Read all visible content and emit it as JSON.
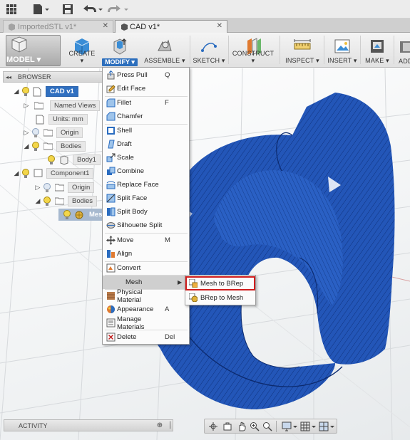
{
  "quick_access": {
    "icons": [
      "grid-icon",
      "file-icon",
      "save-icon",
      "undo-icon",
      "redo-icon"
    ]
  },
  "tabs": [
    {
      "label": "ImportedSTL v1*",
      "active": false
    },
    {
      "label": "CAD v1*",
      "active": true
    }
  ],
  "toolbar": {
    "workspace_label": "MODEL ▾",
    "groups": {
      "create": "CREATE ▾",
      "modify": "MODIFY ▾",
      "assemble": "ASSEMBLE ▾",
      "sketch": "SKETCH ▾",
      "construct": "CONSTRUCT ▾",
      "inspect": "INSPECT ▾",
      "insert": "INSERT ▾",
      "make": "MAKE ▾",
      "addins": "ADD"
    }
  },
  "browser": {
    "title": "BROWSER",
    "collapse_glyph": "◂◂",
    "root": "CAD v1",
    "items": {
      "named_views": "Named Views",
      "units": "Units: mm",
      "origin": "Origin",
      "bodies": "Bodies",
      "body1": "Body1",
      "component": "Component1",
      "comp_origin": "Origin",
      "comp_bodies": "Bodies",
      "mesh": "Mes"
    }
  },
  "modify_menu": {
    "items": [
      {
        "key": "press_pull",
        "label": "Press Pull",
        "shortcut": "Q"
      },
      {
        "key": "edit_face",
        "label": "Edit Face",
        "shortcut": ""
      },
      {
        "key": "fillet",
        "label": "Fillet",
        "shortcut": "F"
      },
      {
        "key": "chamfer",
        "label": "Chamfer",
        "shortcut": ""
      },
      {
        "key": "shell",
        "label": "Shell",
        "shortcut": ""
      },
      {
        "key": "draft",
        "label": "Draft",
        "shortcut": ""
      },
      {
        "key": "scale",
        "label": "Scale",
        "shortcut": ""
      },
      {
        "key": "combine",
        "label": "Combine",
        "shortcut": ""
      },
      {
        "key": "replace_face",
        "label": "Replace Face",
        "shortcut": ""
      },
      {
        "key": "split_face",
        "label": "Split Face",
        "shortcut": ""
      },
      {
        "key": "split_body",
        "label": "Split Body",
        "shortcut": ""
      },
      {
        "key": "silhouette_split",
        "label": "Silhouette Split",
        "shortcut": ""
      },
      {
        "key": "move",
        "label": "Move",
        "shortcut": "M"
      },
      {
        "key": "align",
        "label": "Align",
        "shortcut": ""
      },
      {
        "key": "convert",
        "label": "Convert",
        "shortcut": ""
      },
      {
        "key": "mesh",
        "label": "Mesh",
        "shortcut": "▶"
      },
      {
        "key": "physical_material",
        "label": "Physical Material",
        "shortcut": ""
      },
      {
        "key": "appearance",
        "label": "Appearance",
        "shortcut": "A"
      },
      {
        "key": "manage_materials",
        "label": "Manage Materials",
        "shortcut": ""
      },
      {
        "key": "delete",
        "label": "Delete",
        "shortcut": "Del"
      }
    ]
  },
  "mesh_submenu": {
    "items": [
      {
        "key": "mesh_to_brep",
        "label": "Mesh to BRep",
        "highlighted": true
      },
      {
        "key": "brep_to_mesh",
        "label": "BRep to Mesh",
        "highlighted": false
      }
    ]
  },
  "activity": {
    "label": "ACTIVITY",
    "button_glyph": "⊕",
    "collapse_glyph": "▕"
  },
  "colors": {
    "accent": "#2d6fbd",
    "model": "#2155b5",
    "highlight_frame": "#d01c1c"
  }
}
